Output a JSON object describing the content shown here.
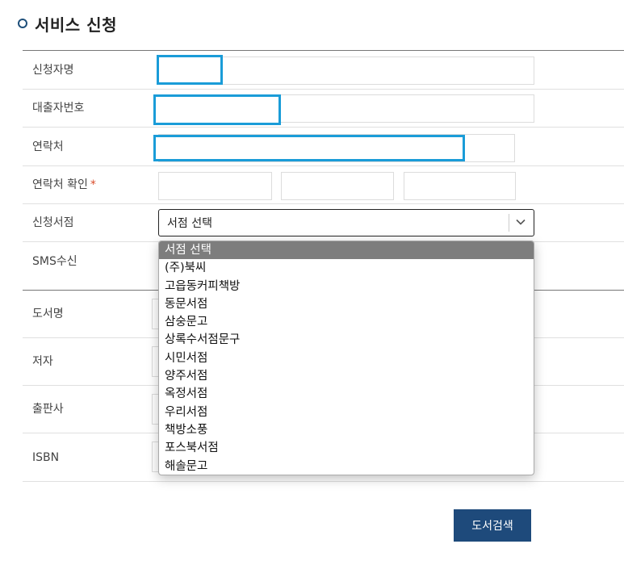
{
  "page": {
    "title": "서비스 신청"
  },
  "form": {
    "applicant_name_label": "신청자명",
    "borrower_no_label": "대출자번호",
    "contact_label": "연락처",
    "contact_confirm_label": "연락처 확인",
    "required_mark": "*",
    "bookstore_label": "신청서점",
    "sms_label": "SMS수신",
    "book_title_label": "도서명",
    "author_label": "저자",
    "publisher_label": "출판사",
    "isbn_label": "ISBN"
  },
  "bookstore_select": {
    "selected": "서점 선택",
    "options": [
      "서점 선택",
      "(주)북씨",
      "고읍동커피책방",
      "동문서점",
      "삼숭문고",
      "상록수서점문구",
      "시민서점",
      "양주서점",
      "옥정서점",
      "우리서점",
      "책방소풍",
      "포스북서점",
      "해솔문고"
    ]
  },
  "actions": {
    "search_book": "도서검색"
  },
  "colors": {
    "accent": "#1e4a7b",
    "focus": "#1a9cd8",
    "required": "#d94c2b",
    "selected_option": "#7d7d7d"
  }
}
